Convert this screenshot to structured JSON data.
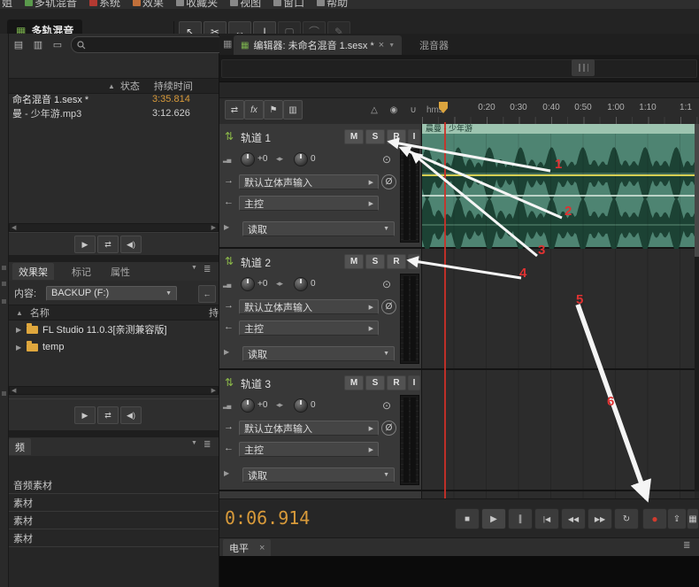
{
  "menubar": {
    "fragment": "姐",
    "items": [
      "多轨混音",
      "系统",
      "效果",
      "收藏夹",
      "视图",
      "窗口",
      "帮助"
    ]
  },
  "window": {
    "app_tab": "多轨混音"
  },
  "files_panel": {
    "columns": {
      "status": "状态",
      "duration": "持续时间"
    },
    "rows": [
      {
        "name": "命名混音 1.sesx *",
        "duration": "3:35.814"
      },
      {
        "name": "曼 - 少年游.mp3",
        "duration": "3:12.626"
      }
    ]
  },
  "browser_panel": {
    "tabs": [
      "效果架",
      "标记",
      "属性"
    ],
    "content_label": "内容:",
    "content_value": "BACKUP (F:)",
    "name_column": "名称",
    "duration_column": "持",
    "folders": [
      "FL Studio 11.0.3[亲测兼容版]",
      "temp"
    ]
  },
  "media_panel": {
    "tab": "频",
    "items": [
      "音频素材",
      "素材",
      "素材",
      "素材"
    ]
  },
  "editor": {
    "tab": "编辑器: 未命名混音 1.sesx *",
    "mixer_tab": "混音器",
    "ruler_unit": "hms",
    "ruler_ticks": [
      "0:20",
      "0:30",
      "0:40",
      "0:50",
      "1:00",
      "1:10",
      "1:1"
    ],
    "clip_title": "晨曼 - 少年游"
  },
  "tracks": {
    "buttons": [
      "M",
      "S",
      "R",
      "I"
    ],
    "list": [
      {
        "name": "轨道 1",
        "volume": "+0",
        "pan": "0",
        "input": "默认立体声输入",
        "output": "主控",
        "automation": "读取"
      },
      {
        "name": "轨道 2",
        "volume": "+0",
        "pan": "0",
        "input": "默认立体声输入",
        "output": "主控",
        "automation": "读取"
      },
      {
        "name": "轨道 3",
        "volume": "+0",
        "pan": "0",
        "input": "默认立体声输入",
        "output": "主控",
        "automation": "读取"
      }
    ]
  },
  "transport": {
    "time": "0:06.914"
  },
  "levels_panel": {
    "tab": "电平"
  },
  "annotations": {
    "labels": [
      "1",
      "2",
      "3",
      "4",
      "5",
      "6"
    ]
  },
  "icons": {
    "close": "×",
    "menu": "≣",
    "dropdown": "▼",
    "submenu": "▶",
    "sort_up": "▲",
    "back": "←",
    "tool_move": "↖",
    "tool_razor": "✂",
    "tool_slip": "↔",
    "tool_text": "I",
    "tool_marquee": "▢",
    "tool_lasso": "⌒",
    "tool_brush": "✎",
    "import": "▤",
    "folder_new": "▥",
    "trash": "▭",
    "play": "▶",
    "stop": "■",
    "pause": "∥",
    "skip_start": "|◀",
    "rewind": "◀◀",
    "ffwd": "▶▶",
    "loop": "↻",
    "record": "●",
    "speaker": "◀)",
    "autoplay": "⇄",
    "crossfade": "⇄",
    "fx": "fx",
    "punch": "⚑",
    "meters": "▥",
    "metronome": "△",
    "monitor": "◉",
    "magnet": "∪",
    "track_type": "⇅",
    "vol_mini": "▂▄",
    "pan_mini": "◂▸",
    "phase": "Ø",
    "sync": "⊙",
    "in_arrow": "→",
    "out_arrow": "←",
    "auto_arrow": "▶",
    "grid": "▦",
    "export": "⇪",
    "film": "▦"
  },
  "colors": {
    "accent_orange": "#d89a3a",
    "clip_green": "#4e8472",
    "playhead_red": "#c83a30"
  }
}
